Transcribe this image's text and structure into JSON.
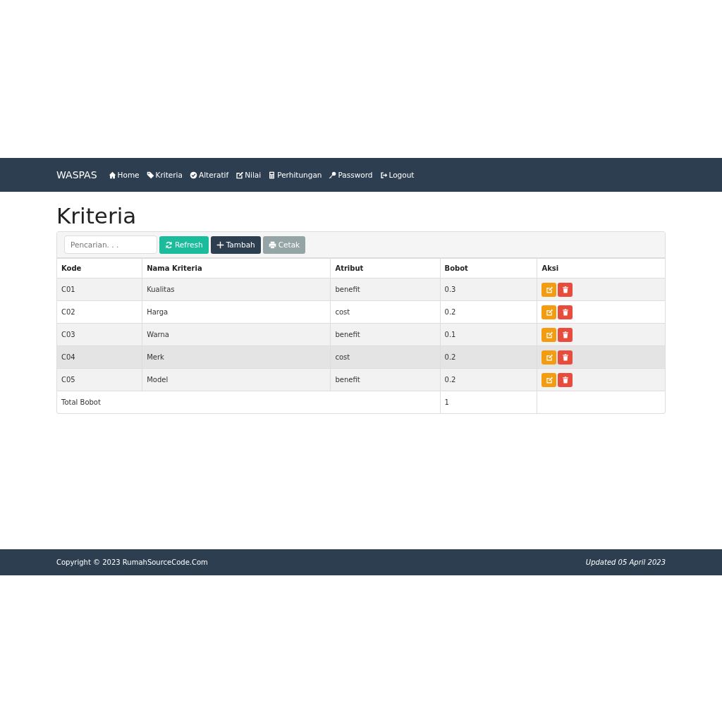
{
  "navbar": {
    "brand": "WASPAS",
    "items": [
      {
        "label": "Home",
        "kind": "home"
      },
      {
        "label": "Kriteria",
        "kind": "tag"
      },
      {
        "label": "Alteratif",
        "kind": "check"
      },
      {
        "label": "Nilai",
        "kind": "edit"
      },
      {
        "label": "Perhitungan",
        "kind": "calc"
      },
      {
        "label": "Password",
        "kind": "key"
      },
      {
        "label": "Logout",
        "kind": "logout"
      }
    ]
  },
  "page_title": "Kriteria",
  "toolbar": {
    "search": {
      "placeholder": "Pencarian. . ."
    },
    "buttons": [
      {
        "label": "Refresh",
        "kind": "refresh"
      },
      {
        "label": "Tambah",
        "kind": "add"
      },
      {
        "label": "Cetak",
        "kind": "print"
      }
    ]
  },
  "table": {
    "columns": [
      "Kode",
      "Nama Kriteria",
      "Atribut",
      "Bobot",
      "Aksi"
    ],
    "rows": [
      {
        "cells": [
          "C01",
          "Kualitas",
          "benefit",
          "0.3"
        ],
        "highlighted": false
      },
      {
        "cells": [
          "C02",
          "Harga",
          "cost",
          "0.2"
        ],
        "highlighted": false
      },
      {
        "cells": [
          "C03",
          "Warna",
          "benefit",
          "0.1"
        ],
        "highlighted": false
      },
      {
        "cells": [
          "C04",
          "Merk",
          "cost",
          "0.2"
        ],
        "highlighted": true
      },
      {
        "cells": [
          "C05",
          "Model",
          "benefit",
          "0.2"
        ],
        "highlighted": false
      }
    ],
    "total": {
      "label": "Total Bobot",
      "value": "1"
    }
  },
  "footer": {
    "copyright": "Copyright © 2023 RumahSourceCode.Com",
    "updated": "Updated 05 April 2023"
  }
}
